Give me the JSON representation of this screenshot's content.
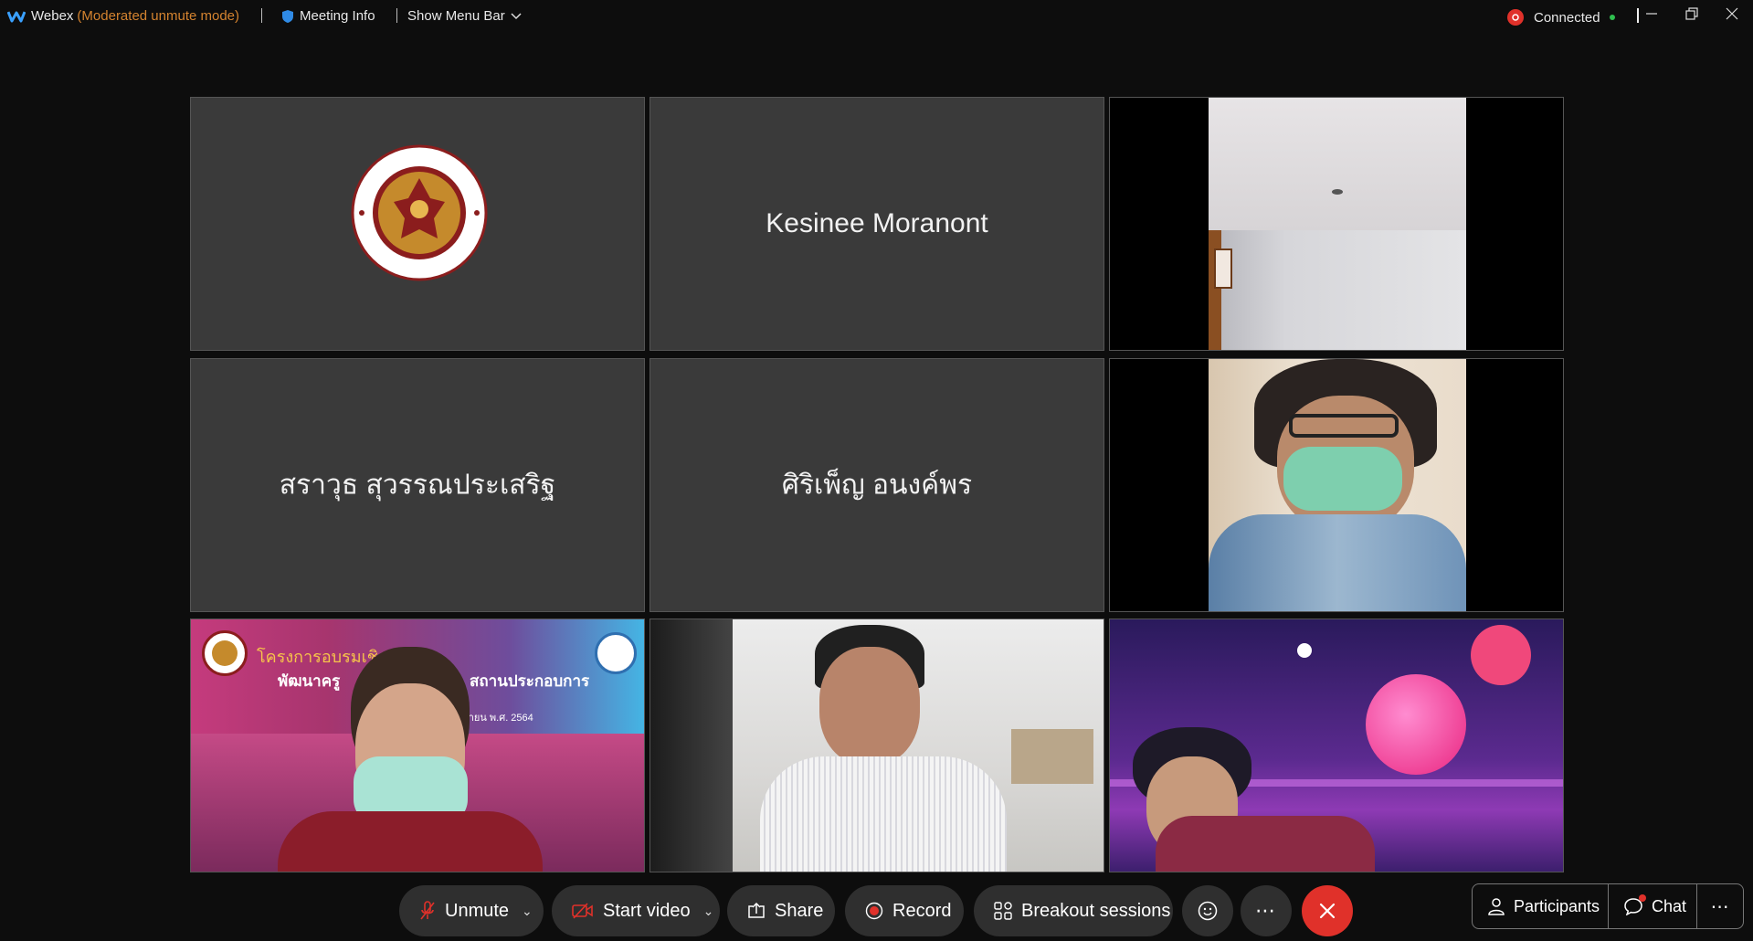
{
  "topbar": {
    "app_name": "Webex",
    "mode": "(Moderated unmute mode)",
    "meeting_info": "Meeting Info",
    "show_menu_bar": "Show Menu Bar",
    "status": "Connected"
  },
  "tiles": [
    {
      "kind": "logo"
    },
    {
      "kind": "name",
      "name": "Kesinee Moranont"
    },
    {
      "kind": "video"
    },
    {
      "kind": "name",
      "name": "สราวุธ สุวรรณประเสริฐ"
    },
    {
      "kind": "name",
      "name": "ศิริเพ็ญ อนงค์พร"
    },
    {
      "kind": "video"
    },
    {
      "kind": "video",
      "overlay_title": "โครงการอบรมเชิงป",
      "overlay_line2": "พัฒนาครู",
      "overlay_line2b": "สถานประกอบการ",
      "overlay_date": "เดือน กันยายน พ.ศ. 2564"
    },
    {
      "kind": "video"
    },
    {
      "kind": "video"
    }
  ],
  "controls": {
    "unmute": "Unmute",
    "start_video": "Start video",
    "share": "Share",
    "record": "Record",
    "breakout": "Breakout sessions",
    "participants": "Participants",
    "chat": "Chat"
  },
  "colors": {
    "mode_text": "#d4832f",
    "end_button": "#e0312a",
    "mute_icon": "#e0312a",
    "connected_dot": "#2fbf4f"
  }
}
